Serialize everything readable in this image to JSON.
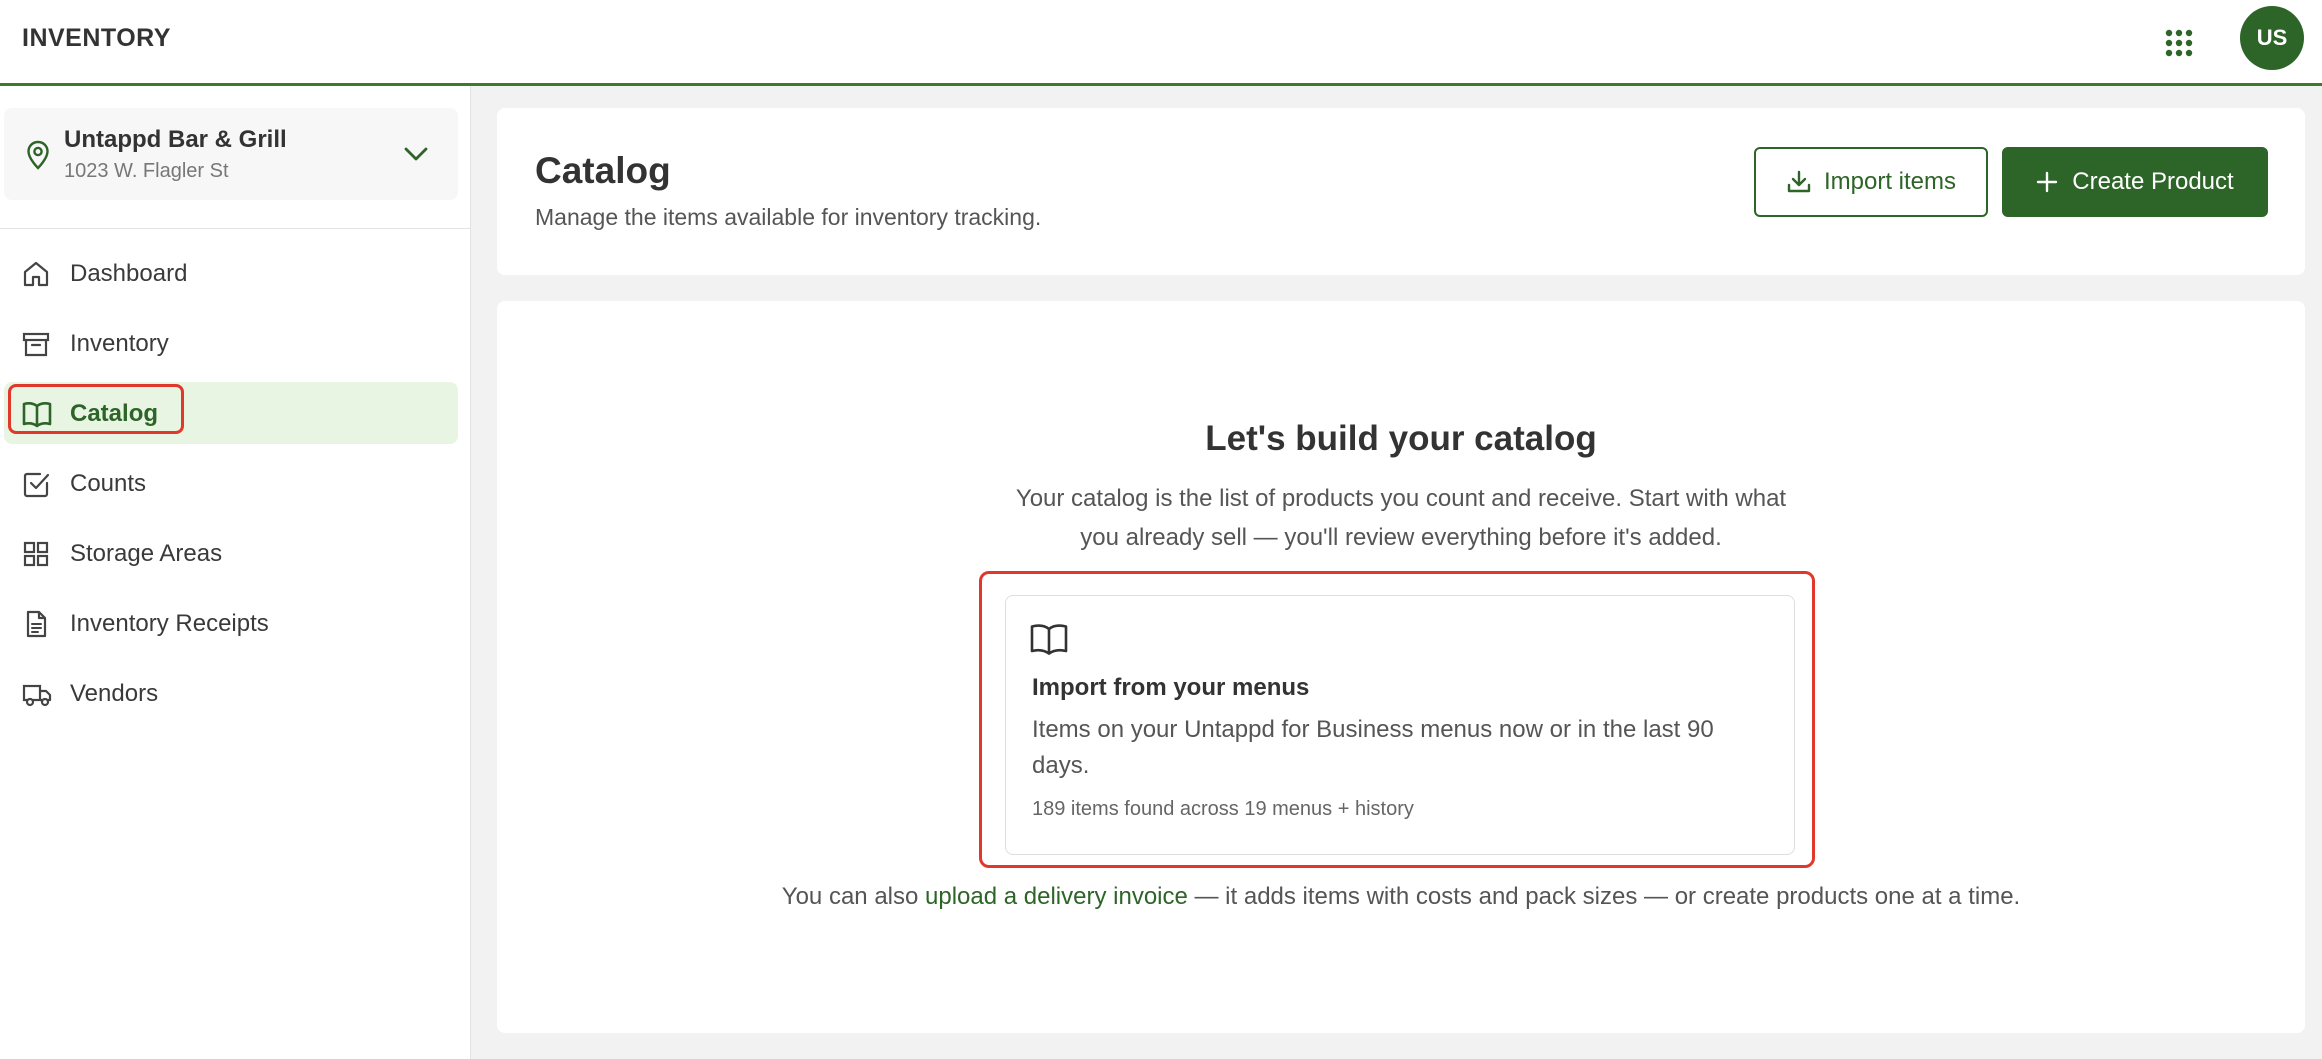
{
  "app": {
    "brand": "INVENTORY",
    "avatar_initials": "US"
  },
  "location": {
    "name": "Untappd Bar & Grill",
    "address": "1023 W. Flagler St"
  },
  "nav": {
    "items": [
      {
        "label": "Dashboard",
        "icon": "home-icon"
      },
      {
        "label": "Inventory",
        "icon": "archive-box-icon"
      },
      {
        "label": "Catalog",
        "icon": "book-open-icon",
        "active": true
      },
      {
        "label": "Counts",
        "icon": "checkbox-icon"
      },
      {
        "label": "Storage Areas",
        "icon": "grid-icon"
      },
      {
        "label": "Inventory Receipts",
        "icon": "document-icon"
      },
      {
        "label": "Vendors",
        "icon": "truck-icon"
      }
    ]
  },
  "header": {
    "title": "Catalog",
    "subtitle": "Manage the items available for inventory tracking.",
    "import_label": "Import items",
    "create_label": "Create Product"
  },
  "empty_state": {
    "title": "Let's build your catalog",
    "description": "Your catalog is the list of products you count and receive. Start with what you already sell — you'll review everything before it's added.",
    "import_card": {
      "title": "Import from your menus",
      "description": "Items on your Untappd for Business menus now or in the last 90 days.",
      "meta": "189 items found across 19 menus + history"
    },
    "footer_prefix": "You can also ",
    "footer_link": "upload a delivery invoice",
    "footer_suffix": " — it adds items with costs and pack sizes — or create products one at a time."
  },
  "colors": {
    "brand_green": "#2d6427",
    "active_bg": "#e8f5e3",
    "highlight_red": "#e0392b"
  }
}
